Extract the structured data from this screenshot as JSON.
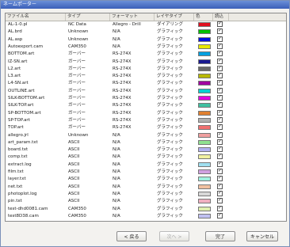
{
  "window": {
    "title": "ネームポーター"
  },
  "columns": [
    "ファイル名",
    "タイプ",
    "フォーマット",
    "レイヤタイプ",
    "色",
    "読込"
  ],
  "rows": [
    {
      "name": "AL-1-0.pl",
      "type": "NC Data",
      "format": "Allegro - Drill",
      "layer": "ダイアリング",
      "color": "#e01020"
    },
    {
      "name": "AL.brd",
      "type": "Unknown",
      "format": "N/A",
      "layer": "グラフィック",
      "color": "#00c000"
    },
    {
      "name": "AL.asp",
      "type": "Unknown",
      "format": "N/A",
      "layer": "グラフィック",
      "color": "#0010e0"
    },
    {
      "name": "Autoexport.cam",
      "type": "CAM350",
      "format": "N/A",
      "layer": "グラフィック",
      "color": "#e8e800"
    },
    {
      "name": "BOTTOM.art",
      "type": "ガーバー",
      "format": "RS-274X",
      "layer": "グラフィック",
      "color": "#00a0e0"
    },
    {
      "name": "IZ-SN.art",
      "type": "ガーバー",
      "format": "RS-274X",
      "layer": "グラフィック",
      "color": "#1a1a90"
    },
    {
      "name": "L2.art",
      "type": "ガーバー",
      "format": "RS-274X",
      "layer": "グラフィック",
      "color": "#6a6a6a"
    },
    {
      "name": "L3.art",
      "type": "ガーバー",
      "format": "RS-274X",
      "layer": "グラフィック",
      "color": "#b8b800"
    },
    {
      "name": "L4-SN.art",
      "type": "ガーバー",
      "format": "RS-274X",
      "layer": "グラフィック",
      "color": "#a000a0"
    },
    {
      "name": "OUTLINE.art",
      "type": "ガーバー",
      "format": "RS-274X",
      "layer": "グラフィック",
      "color": "#00d0d0"
    },
    {
      "name": "SILK-BOTTOM.art",
      "type": "ガーバー",
      "format": "RS-274X",
      "layer": "グラフィック",
      "color": "#e000e0"
    },
    {
      "name": "SILK-TOP.art",
      "type": "ガーバー",
      "format": "RS-274X",
      "layer": "グラフィック",
      "color": "#40c0a0"
    },
    {
      "name": "SP-BOTTOM.art",
      "type": "ガーバー",
      "format": "RS-274X",
      "layer": "グラフィック",
      "color": "#e08030"
    },
    {
      "name": "SP-TOP.art",
      "type": "ガーバー",
      "format": "RS-274X",
      "layer": "グラフィック",
      "color": "#b0b0b0"
    },
    {
      "name": "TOP.art",
      "type": "ガーバー",
      "format": "RS-274X",
      "layer": "グラフィック",
      "color": "#f07070"
    },
    {
      "name": "allegro.jrl",
      "type": "Unknown",
      "format": "N/A",
      "layer": "グラフィック",
      "color": "#f0a0a0"
    },
    {
      "name": "art_param.txt",
      "type": "ASCII",
      "format": "N/A",
      "layer": "グラフィック",
      "color": "#90e090"
    },
    {
      "name": "board.txt",
      "type": "ASCII",
      "format": "N/A",
      "layer": "グラフィック",
      "color": "#b0b0f0"
    },
    {
      "name": "comp.txt",
      "type": "ASCII",
      "format": "N/A",
      "layer": "グラフィック",
      "color": "#f0f0a0"
    },
    {
      "name": "extract.log",
      "type": "ASCII",
      "format": "N/A",
      "layer": "グラフィック",
      "color": "#a0e0f0"
    },
    {
      "name": "film.txt",
      "type": "ASCII",
      "format": "N/A",
      "layer": "グラフィック",
      "color": "#d0a0e0"
    },
    {
      "name": "layer.txt",
      "type": "ASCII",
      "format": "N/A",
      "layer": "グラフィック",
      "color": "#a0f0e0"
    },
    {
      "name": "net.txt",
      "type": "ASCII",
      "format": "N/A",
      "layer": "グラフィック",
      "color": "#f0c0a0"
    },
    {
      "name": "photoplot.log",
      "type": "ASCII",
      "format": "N/A",
      "layer": "グラフィック",
      "color": "#d8d8d8"
    },
    {
      "name": "pin.txt",
      "type": "ASCII",
      "format": "N/A",
      "layer": "グラフィック",
      "color": "#f0b0c0"
    },
    {
      "name": "test-dhd0081.cam",
      "type": "CAM350",
      "format": "N/A",
      "layer": "グラフィック",
      "color": "#e0f0b0"
    },
    {
      "name": "test8D38.cam",
      "type": "CAM350",
      "format": "N/A",
      "layer": "グラフィック",
      "color": "#c0c0f0"
    }
  ],
  "buttons": {
    "back": "< 戻る",
    "next": "次へ >",
    "finish": "完了",
    "cancel": "キャンセル"
  }
}
